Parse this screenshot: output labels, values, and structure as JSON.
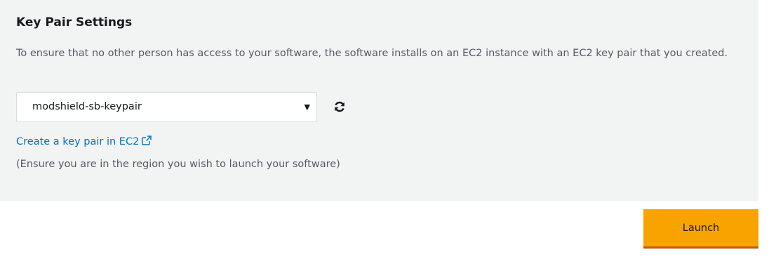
{
  "key_pair": {
    "title": "Key Pair Settings",
    "description": "To ensure that no other person has access to your software, the software installs on an EC2 instance with an EC2 key pair that you created.",
    "selected_key_pair": "modshield-sb-keypair",
    "caret_glyph": "▼",
    "refresh_icon": "refresh-icon",
    "create_link": "Create a key pair in EC2",
    "external_icon": "external-link-icon",
    "note": "(Ensure you are in the region you wish to launch your software)"
  },
  "actions": {
    "launch_label": "Launch"
  },
  "colors": {
    "panel_background": "#f2f3f3",
    "link": "#0073bb",
    "launch_button": "#f8a300",
    "launch_button_border": "#c35a14"
  }
}
